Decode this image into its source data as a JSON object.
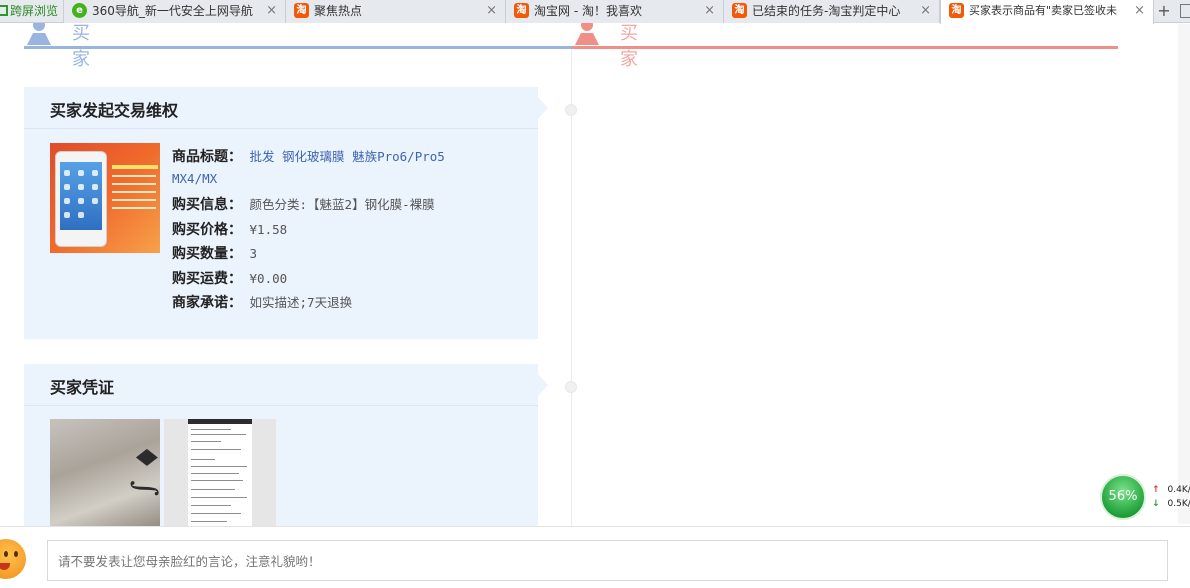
{
  "tabs": {
    "cross_browse": "跨屏浏览",
    "items": [
      {
        "icon": "360-nav-icon",
        "label": "360导航_新一代安全上网导航",
        "close": "×"
      },
      {
        "icon": "taobao-icon",
        "label": "聚焦热点",
        "close": "×"
      },
      {
        "icon": "taobao-icon",
        "label": "淘宝网 - 淘！我喜欢",
        "close": "×"
      },
      {
        "icon": "taobao-icon",
        "label": "已结束的任务-淘宝判定中心",
        "close": "×"
      },
      {
        "icon": "taobao-icon",
        "label": "买家表示商品有\"卖家已签收未",
        "close": "×"
      }
    ],
    "new_tab": "+"
  },
  "roles": {
    "buyer_label": "买家",
    "seller_label": "买家"
  },
  "dispute_card": {
    "title": "买家发起交易维权",
    "fields": {
      "title_label": "商品标题：",
      "title_value_line1": "批发 钢化玻璃膜 魅族Pro6/Pro5",
      "title_value_line2": "MX4/MX",
      "info_label": "购买信息：",
      "info_value": "颜色分类:【魅蓝2】钢化膜-裸膜",
      "price_label": "购买价格：",
      "price_value": "¥1.58",
      "qty_label": "购买数量：",
      "qty_value": "3",
      "shipping_label": "购买运费：",
      "shipping_value": "¥0.00",
      "promise_label": "商家承诺：",
      "promise_value": "如实描述;7天退换"
    }
  },
  "evidence_card": {
    "title": "买家凭证"
  },
  "comment": {
    "placeholder": "请不要发表让您母亲脸红的言论，注意礼貌哟！"
  },
  "speed_widget": {
    "percent": "56%",
    "up_arrow": "↑",
    "up": "0.4K/",
    "down_arrow": "↓",
    "down": "0.5K/"
  },
  "colors": {
    "buyer_accent": "#9ab4e2",
    "seller_accent": "#f08f87",
    "card_bg": "#ebf3fd",
    "link": "#3d64b0"
  }
}
